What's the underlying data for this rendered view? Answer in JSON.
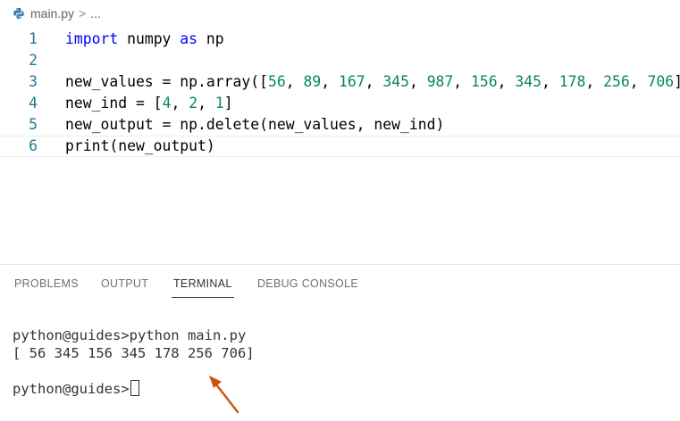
{
  "breadcrumb": {
    "file": "main.py",
    "separator": ">",
    "more": "..."
  },
  "editor": {
    "lines": [
      {
        "number": "1",
        "tokens": [
          {
            "t": "import",
            "c": "kw"
          },
          {
            "t": " numpy ",
            "c": ""
          },
          {
            "t": "as",
            "c": "kw"
          },
          {
            "t": " np",
            "c": ""
          }
        ]
      },
      {
        "number": "2",
        "tokens": []
      },
      {
        "number": "3",
        "tokens": [
          {
            "t": "new_values = np.array([",
            "c": ""
          },
          {
            "t": "56",
            "c": "num"
          },
          {
            "t": ", ",
            "c": ""
          },
          {
            "t": "89",
            "c": "num"
          },
          {
            "t": ", ",
            "c": ""
          },
          {
            "t": "167",
            "c": "num"
          },
          {
            "t": ", ",
            "c": ""
          },
          {
            "t": "345",
            "c": "num"
          },
          {
            "t": ", ",
            "c": ""
          },
          {
            "t": "987",
            "c": "num"
          },
          {
            "t": ", ",
            "c": ""
          },
          {
            "t": "156",
            "c": "num"
          },
          {
            "t": ", ",
            "c": ""
          },
          {
            "t": "345",
            "c": "num"
          },
          {
            "t": ", ",
            "c": ""
          },
          {
            "t": "178",
            "c": "num"
          },
          {
            "t": ", ",
            "c": ""
          },
          {
            "t": "256",
            "c": "num"
          },
          {
            "t": ", ",
            "c": ""
          },
          {
            "t": "706",
            "c": "num"
          },
          {
            "t": "])",
            "c": ""
          }
        ]
      },
      {
        "number": "4",
        "tokens": [
          {
            "t": "new_ind = [",
            "c": ""
          },
          {
            "t": "4",
            "c": "num"
          },
          {
            "t": ", ",
            "c": ""
          },
          {
            "t": "2",
            "c": "num"
          },
          {
            "t": ", ",
            "c": ""
          },
          {
            "t": "1",
            "c": "num"
          },
          {
            "t": "]",
            "c": ""
          }
        ]
      },
      {
        "number": "5",
        "tokens": [
          {
            "t": "new_output = np.delete(new_values, new_ind)",
            "c": ""
          }
        ]
      },
      {
        "number": "6",
        "tokens": [
          {
            "t": "print(new_output)",
            "c": ""
          }
        ]
      }
    ]
  },
  "panel": {
    "tabs": [
      {
        "label": "PROBLEMS",
        "active": false
      },
      {
        "label": "OUTPUT",
        "active": false
      },
      {
        "label": "TERMINAL",
        "active": true
      },
      {
        "label": "DEBUG CONSOLE",
        "active": false
      }
    ]
  },
  "terminal": {
    "command_line": "python@guides>python main.py",
    "output_line": "[ 56 345 156 345 178 256 706]",
    "prompt": "python@guides>"
  },
  "colors": {
    "keyword": "#0000ff",
    "number": "#098658",
    "line_number": "#237893",
    "arrow": "#c8550f"
  }
}
